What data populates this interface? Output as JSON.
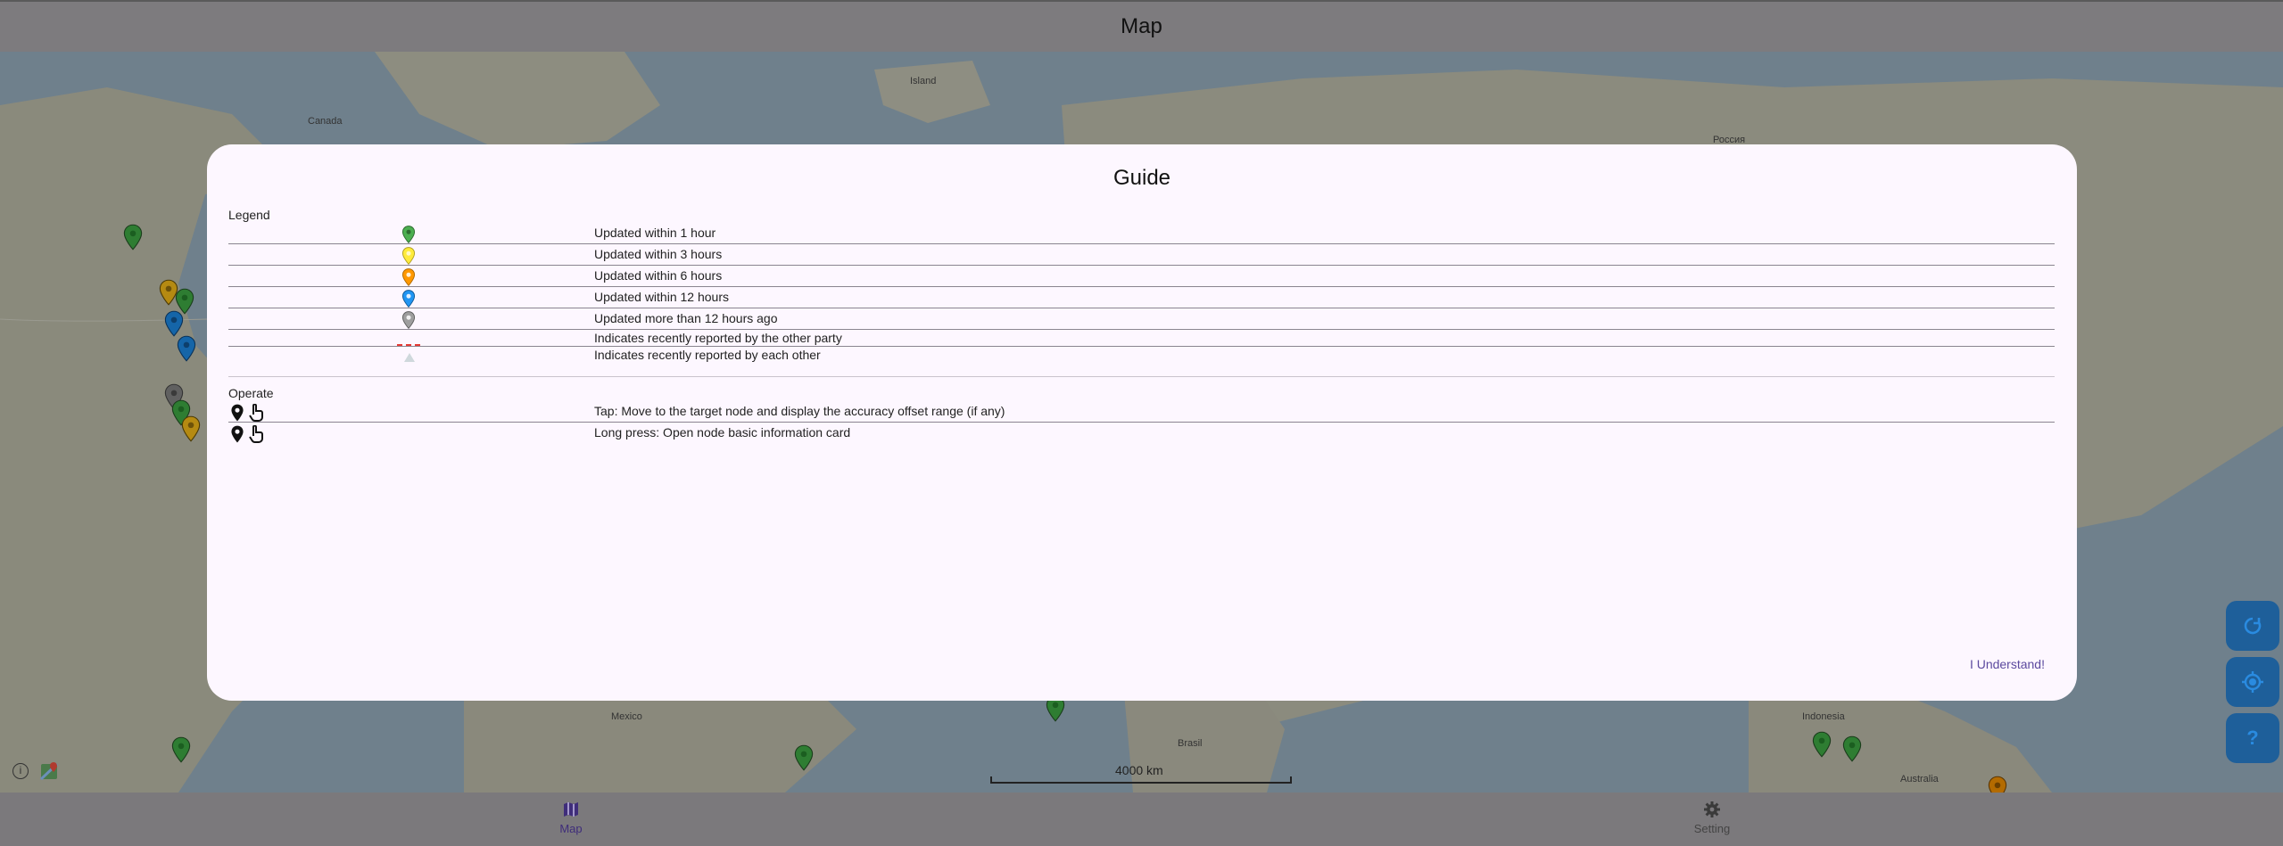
{
  "app": {
    "title": "Map"
  },
  "map": {
    "labels": [
      "Canada",
      "Island",
      "Россия",
      "Mexico",
      "Brasil",
      "Indonesia",
      "Australia"
    ],
    "scale": "4000 km",
    "icons": {
      "info": "info-icon",
      "maps": "google-maps-icon"
    }
  },
  "fabs": [
    {
      "name": "refresh-fab",
      "icon": "refresh-icon"
    },
    {
      "name": "my-location-fab",
      "icon": "my-location-icon"
    },
    {
      "name": "help-fab",
      "icon": "question-icon",
      "text": "?"
    }
  ],
  "dialog": {
    "title": "Guide",
    "legend": {
      "label": "Legend",
      "items": [
        {
          "icon": "green-pin-icon",
          "color": "#4caf50",
          "text": "Updated within 1 hour"
        },
        {
          "icon": "yellow-pin-icon",
          "color": "#ffeb3b",
          "text": "Updated within 3 hours"
        },
        {
          "icon": "orange-pin-icon",
          "color": "#ff9800",
          "text": "Updated within 6 hours"
        },
        {
          "icon": "blue-pin-icon",
          "color": "#2196f3",
          "text": "Updated within 12 hours"
        },
        {
          "icon": "grey-pin-icon",
          "color": "#9e9e9e",
          "text": "Updated more than 12 hours ago"
        },
        {
          "icon": "red-dashed-line-icon",
          "color": "#e53935",
          "text": "Indicates recently reported by the other party"
        },
        {
          "icon": "grey-triangle-icon",
          "color": "#cfd8dc",
          "text": "Indicates recently reported by each other"
        }
      ]
    },
    "operate": {
      "label": "Operate",
      "items": [
        {
          "icons": [
            "pin-icon",
            "tap-hand-icon"
          ],
          "text": "Tap: Move to the target node and display the accuracy offset range (if any)"
        },
        {
          "icons": [
            "pin-icon",
            "long-press-hand-icon"
          ],
          "text": "Long press: Open node basic information card"
        }
      ]
    },
    "confirm_label": "I Understand!"
  },
  "bottom_nav": {
    "items": [
      {
        "label": "Map",
        "icon": "map-icon",
        "selected": true
      },
      {
        "label": "Setting",
        "icon": "gear-icon",
        "selected": false
      }
    ]
  }
}
